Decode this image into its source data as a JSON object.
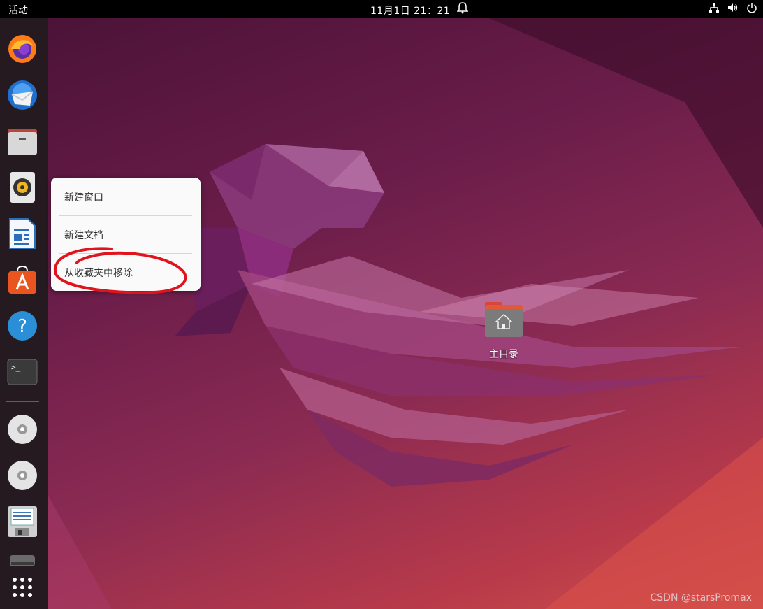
{
  "topbar": {
    "activities": "活动",
    "clock": "11月1日  21：21",
    "icons": [
      "alarm-bell-icon",
      "network-icon",
      "volume-icon",
      "power-icon"
    ]
  },
  "dock": {
    "apps": [
      "firefox-icon",
      "thunderbird-icon",
      "files-icon",
      "rhythmbox-icon",
      "libreoffice-writer-icon",
      "software-center-icon",
      "help-icon",
      "terminal-icon"
    ],
    "devices": [
      "cdrom-icon",
      "cdrom-icon",
      "floppy-disk-icon",
      "drive-icon"
    ],
    "show_apps": "app-grid-icon"
  },
  "context_menu": {
    "new_window": "新建窗口",
    "new_document": "新建文档",
    "remove_favorite": "从收藏夹中移除"
  },
  "desktop": {
    "home_label": "主目录"
  },
  "watermark": "CSDN @starsPromax",
  "colors": {
    "topbar": "#000000",
    "dock": "#241a20",
    "annotation": "#e0141c"
  }
}
